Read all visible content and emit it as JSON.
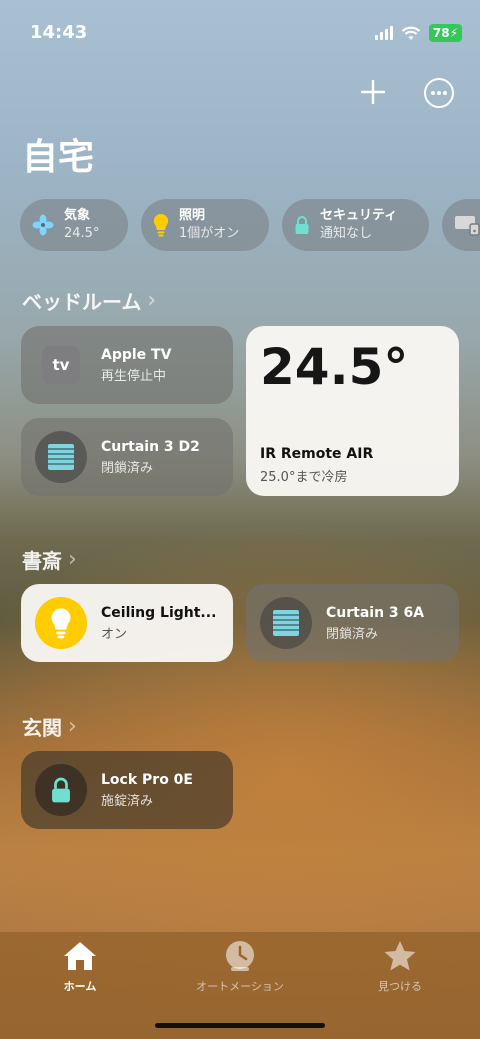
{
  "status_bar": {
    "time": "14:43",
    "battery": "78"
  },
  "header": {
    "title": "自宅"
  },
  "chips": [
    {
      "label": "気象",
      "value": "24.5°",
      "icon": "fan-icon"
    },
    {
      "label": "照明",
      "value": "1個がオン",
      "icon": "lightbulb-icon"
    },
    {
      "label": "セキュリティ",
      "value": "通知なし",
      "icon": "lock-icon"
    },
    {
      "label": "",
      "value": "",
      "icon": "display-icon"
    }
  ],
  "sections": {
    "bedroom": {
      "title": "ベッドルーム",
      "apple_tv": {
        "name": "Apple TV",
        "status": "再生停止中",
        "icon_text": "tv"
      },
      "curtain": {
        "name": "Curtain 3 D2",
        "status": "閉鎖済み"
      },
      "ir_remote": {
        "temperature": "24.5°",
        "name": "IR Remote AIR",
        "status": "25.0°まで冷房"
      }
    },
    "study": {
      "title": "書斎",
      "ceiling_light": {
        "name": "Ceiling Light...",
        "status": "オン"
      },
      "curtain": {
        "name": "Curtain 3 6A",
        "status": "閉鎖済み"
      }
    },
    "entrance": {
      "title": "玄関",
      "lock": {
        "name": "Lock Pro 0E",
        "status": "施錠済み"
      }
    }
  },
  "tabs": [
    {
      "label": "ホーム",
      "icon": "house-icon",
      "active": true
    },
    {
      "label": "オートメーション",
      "icon": "clock-icon",
      "active": false
    },
    {
      "label": "見つける",
      "icon": "star-icon",
      "active": false
    }
  ],
  "colors": {
    "accent_yellow": "#ffcc00",
    "curtain_teal": "#7fd4e0",
    "lock_teal": "#6fe0d0",
    "battery_green": "#34c759"
  }
}
